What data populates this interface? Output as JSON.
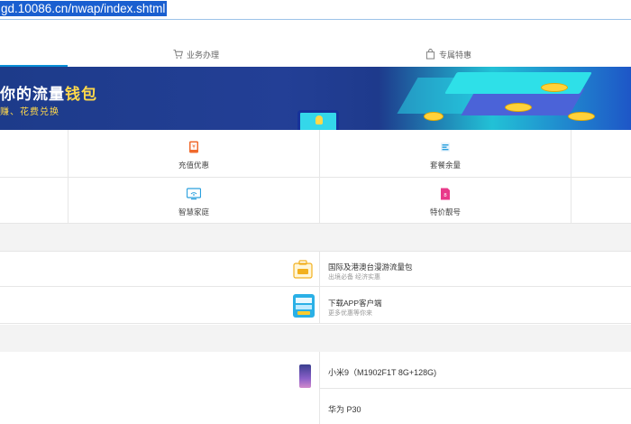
{
  "address_bar": {
    "url": "gd.10086.cn/nwap/index.shtml"
  },
  "topnav": {
    "items": [
      {
        "label": "业务办理",
        "icon": "cart-icon"
      },
      {
        "label": "专属特惠",
        "icon": "bag-icon"
      }
    ],
    "active_color": "#0a8fd6"
  },
  "banner": {
    "title_white": "你的流量",
    "title_gold": "钱包",
    "subtitle": "赚、花费兑换"
  },
  "services": [
    {
      "label": "充值优惠",
      "icon": "phone-recharge-icon",
      "color": "#f06a2d"
    },
    {
      "label": "套餐余量",
      "icon": "package-balance-icon",
      "color": "#2aa0de"
    },
    {
      "label": "智慧家庭",
      "icon": "smart-home-tv-icon",
      "color": "#2aa0de"
    },
    {
      "label": "特价靓号",
      "icon": "sim-card-icon",
      "color": "#e83a8a"
    }
  ],
  "promos": [
    {
      "title": "国际及港澳台漫游流量包",
      "subtitle": "出境必备 经济实惠",
      "icon": "roaming-package-icon"
    },
    {
      "title": "下载APP客户端",
      "subtitle": "更多优惠等你来",
      "icon": "app-download-icon"
    }
  ],
  "phones": [
    {
      "name": "小米9（M1902F1T 8G+128G)"
    },
    {
      "name": "华为 P30"
    }
  ]
}
